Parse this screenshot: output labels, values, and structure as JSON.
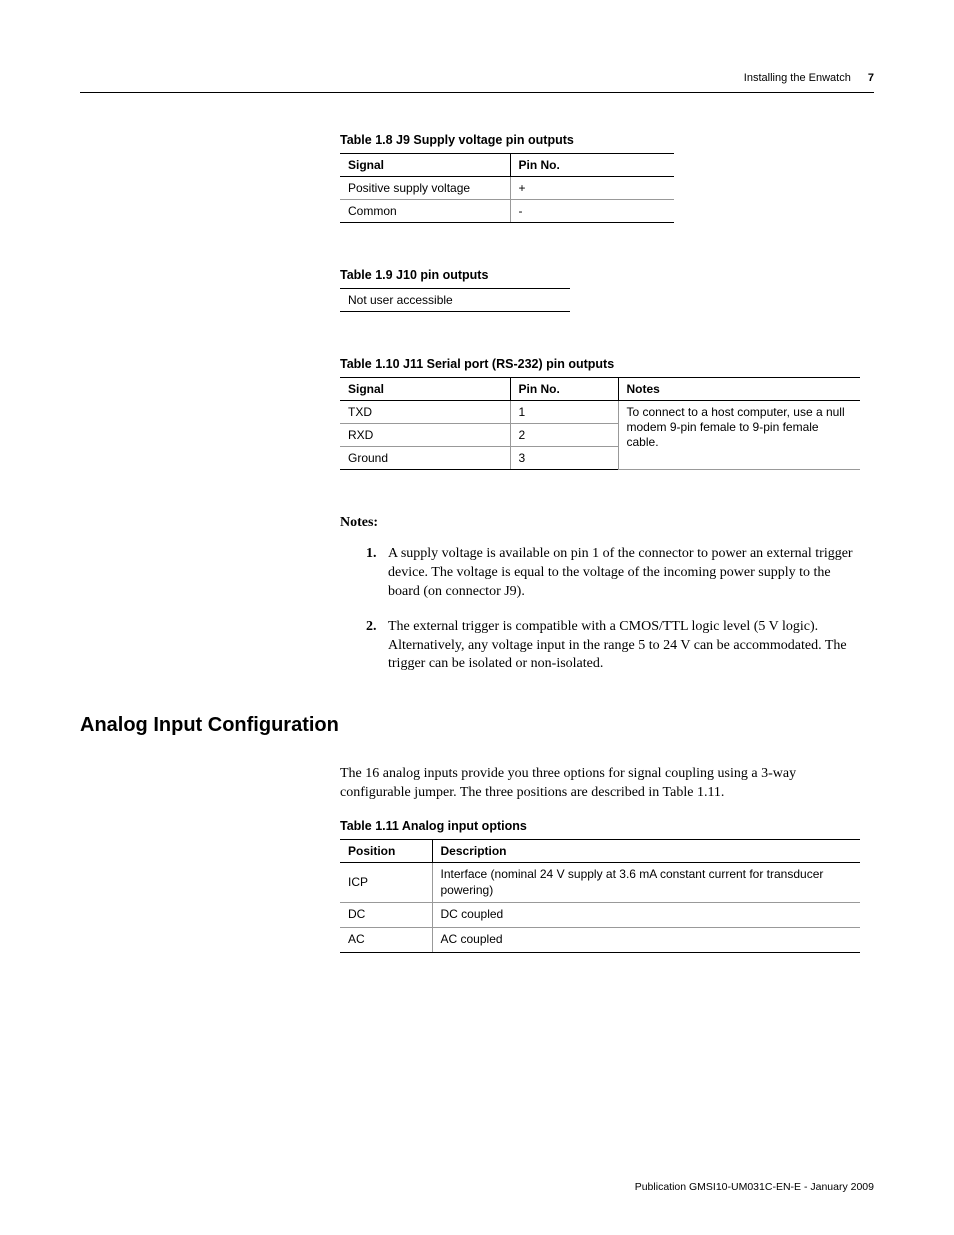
{
  "header": {
    "running_title": "Installing the Enwatch",
    "page_number": "7"
  },
  "table18": {
    "caption": "Table 1.8 J9 Supply voltage pin outputs",
    "headers": [
      "Signal",
      "Pin No."
    ],
    "rows": [
      [
        "Positive supply voltage",
        "+"
      ],
      [
        "Common",
        "-"
      ]
    ]
  },
  "table19": {
    "caption": "Table 1.9 J10 pin outputs",
    "cell": "Not user accessible"
  },
  "table110": {
    "caption": "Table 1.10 J11 Serial port (RS-232) pin outputs",
    "headers": [
      "Signal",
      "Pin No.",
      "Notes"
    ],
    "rows": [
      [
        "TXD",
        "1"
      ],
      [
        "RXD",
        "2"
      ],
      [
        "Ground",
        "3"
      ]
    ],
    "notes_cell": "To connect to a host computer, use a null modem 9-pin female to 9-pin female cable."
  },
  "notes": {
    "label": "Notes:",
    "items": [
      {
        "num": "1.",
        "text": "A supply voltage is available on pin 1 of the connector to power an external trigger device. The voltage is equal to the voltage of the incoming power supply to the board (on connector J9)."
      },
      {
        "num": "2.",
        "text": "The external trigger is compatible with a CMOS/TTL logic level (5 V logic). Alternatively, any voltage input in the range 5 to 24 V can be accommodated. The trigger can be isolated or non-isolated."
      }
    ]
  },
  "section": {
    "heading": "Analog Input Configuration",
    "body": "The 16 analog inputs provide you three options for signal coupling using a 3-way configurable jumper. The three positions are described in Table 1.11."
  },
  "table111": {
    "caption": "Table 1.11 Analog input options",
    "headers": [
      "Position",
      "Description"
    ],
    "rows": [
      [
        "ICP",
        "Interface (nominal 24 V supply at 3.6 mA constant current for transducer powering)"
      ],
      [
        "DC",
        "DC coupled"
      ],
      [
        "AC",
        "AC coupled"
      ]
    ]
  },
  "footer": {
    "text": "Publication GMSI10-UM031C-EN-E - January 2009"
  }
}
